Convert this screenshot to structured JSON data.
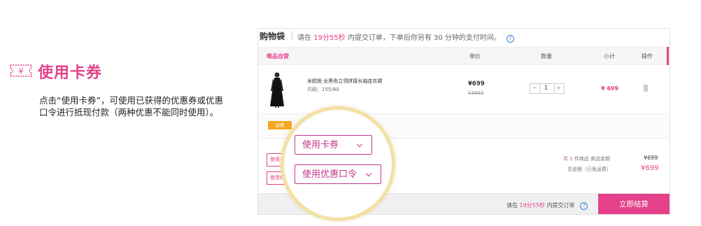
{
  "intro": {
    "title": "使用卡券",
    "description": "点击“使用卡券”，可使用已获得的优惠券或优惠口令进行抵现付款（两种优惠不能同时使用）。"
  },
  "cart": {
    "title": "购物袋",
    "notice": {
      "prefix": "请在",
      "time": "19分55秒",
      "suffix": "内提交订单，下单后你另有 30 分钟的支付时间。"
    },
    "header": {
      "seller": "唯品自营",
      "price": "单价",
      "quantity": "数量",
      "subtotal": "小计",
      "action": "操作"
    },
    "item": {
      "name": "米欧妮·女黑色立领拼接长袖连衣裙",
      "size": "尺码：155/80",
      "price": "¥699",
      "original_price": "¥3860",
      "quantity": "1",
      "subtotal": "¥ 699",
      "stepper_minus": "−",
      "stepper_plus": "+"
    },
    "freight_badge": "运费",
    "left_buttons": [
      "使用卡券",
      "使用优惠口令"
    ],
    "summary": {
      "count_prefix": "共",
      "count": "1",
      "count_suffix": "件商品  商品金额",
      "goods_amount": "¥699",
      "total_label": "总金额（已免运费）",
      "total_amount": "¥699"
    },
    "bottom": {
      "prefix": "请在",
      "time": "19分55秒",
      "suffix": "内提交订单",
      "checkout": "立即结算"
    }
  },
  "magnifier": {
    "use_coupon": "使用卡券",
    "use_promo_code": "使用优惠口令"
  },
  "colors": {
    "accent": "#e4418a",
    "magnifier_ring": "#f3e1a4",
    "badge": "#f5a623"
  }
}
